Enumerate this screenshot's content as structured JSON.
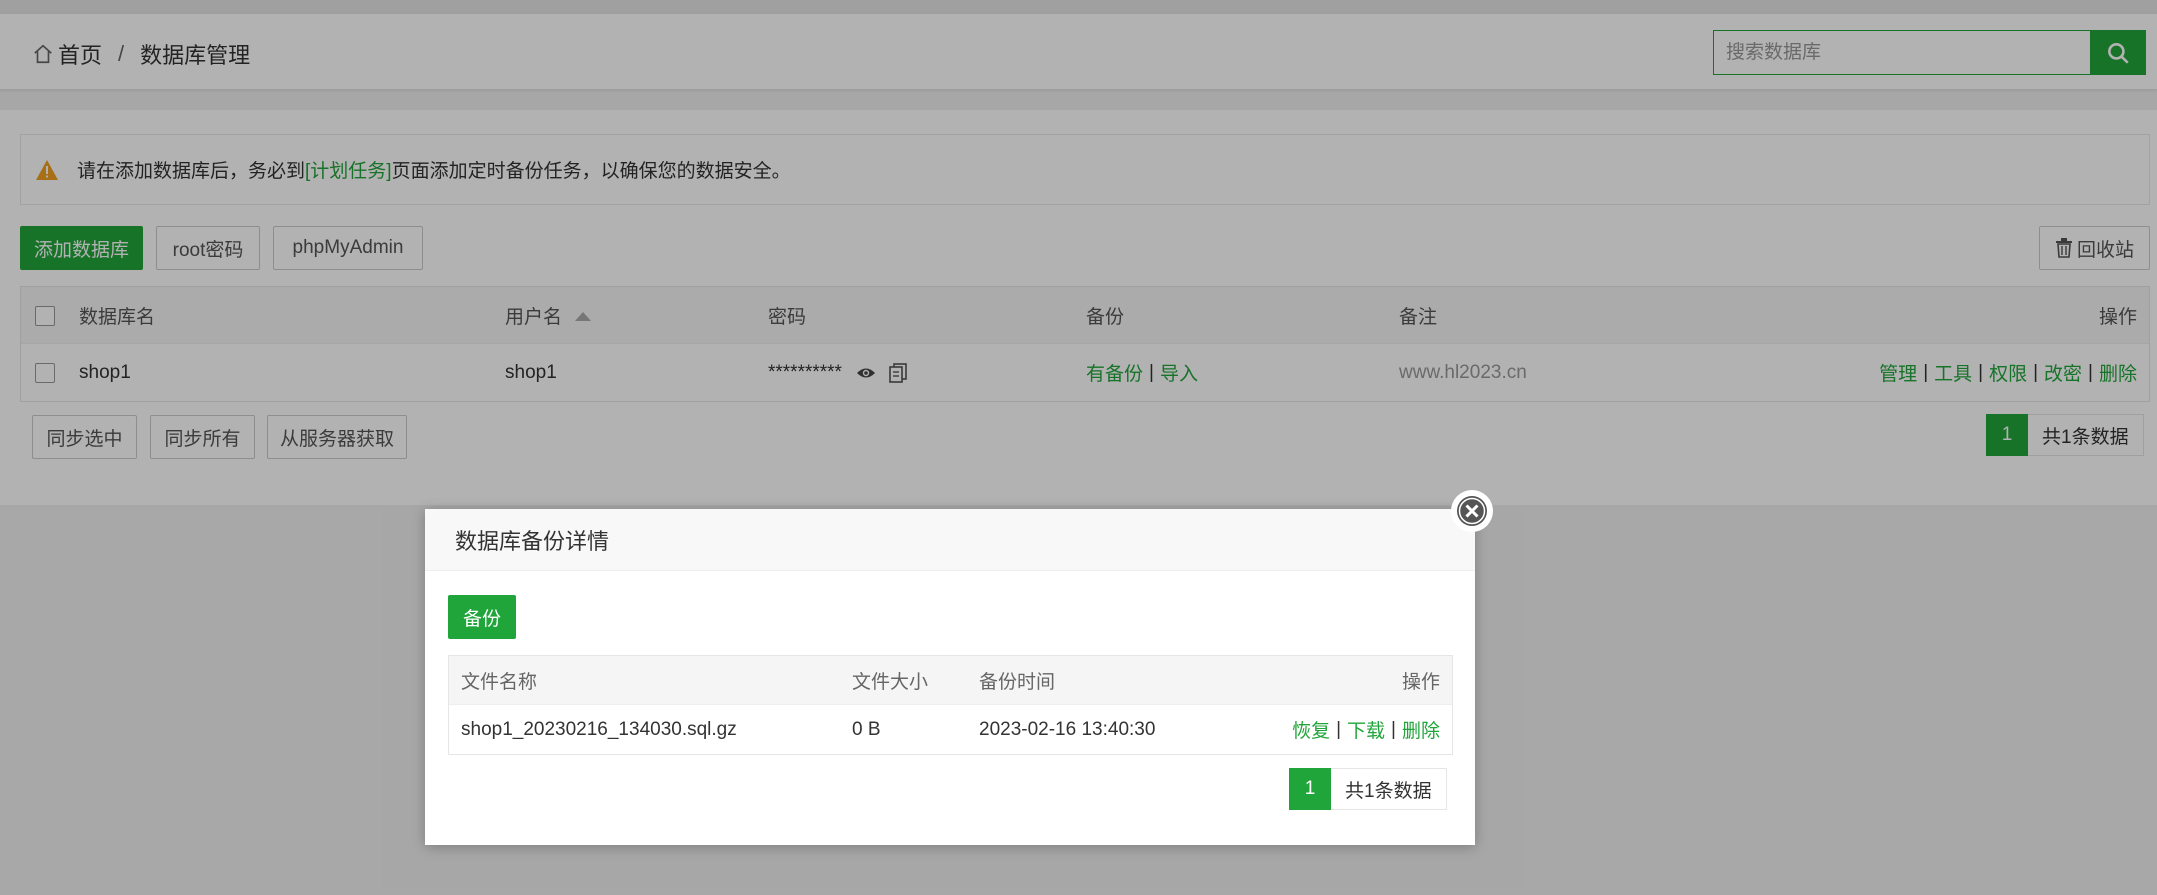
{
  "breadcrumb": {
    "home": "首页",
    "separator": "/",
    "current": "数据库管理"
  },
  "search": {
    "placeholder": "搜索数据库"
  },
  "alert": {
    "prefix": "请在添加数据库后，务必到",
    "link": "[计划任务]",
    "suffix": "页面添加定时备份任务，以确保您的数据安全。"
  },
  "toolbar": {
    "add_db": "添加数据库",
    "root_pwd": "root密码",
    "phpmyadmin": "phpMyAdmin",
    "recycle": "回收站"
  },
  "table": {
    "headers": {
      "name": "数据库名",
      "user": "用户名",
      "password": "密码",
      "backup": "备份",
      "note": "备注",
      "ops": "操作"
    },
    "rows": [
      {
        "name": "shop1",
        "user": "shop1",
        "password": "**********",
        "backup_has": "有备份",
        "backup_import": "导入",
        "note": "www.hl2023.cn",
        "ops": {
          "manage": "管理",
          "tools": "工具",
          "perm": "权限",
          "chpwd": "改密",
          "delete": "删除"
        }
      }
    ]
  },
  "footer_buttons": {
    "sync_selected": "同步选中",
    "sync_all": "同步所有",
    "fetch_server": "从服务器获取"
  },
  "pager": {
    "page": "1",
    "total": "共1条数据"
  },
  "modal": {
    "title": "数据库备份详情",
    "backup_button": "备份",
    "headers": {
      "filename": "文件名称",
      "size": "文件大小",
      "time": "备份时间",
      "ops": "操作"
    },
    "rows": [
      {
        "filename": "shop1_20230216_134030.sql.gz",
        "size": "0 B",
        "time": "2023-02-16 13:40:30",
        "restore": "恢复",
        "download": "下载",
        "delete": "删除"
      }
    ],
    "pager": {
      "page": "1",
      "total": "共1条数据"
    }
  },
  "colors": {
    "accent": "#20a53a",
    "warning": "#f0a020"
  }
}
